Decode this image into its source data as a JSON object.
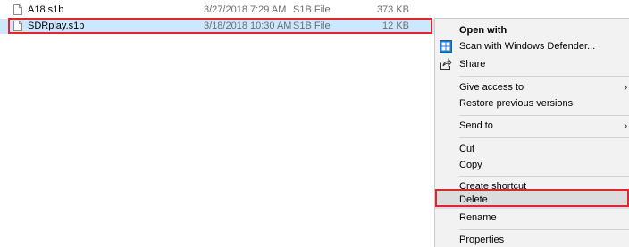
{
  "files": [
    {
      "name": "A18.s1b",
      "date": "3/27/2018 7:29 AM",
      "type": "S1B File",
      "size": "373 KB"
    },
    {
      "name": "SDRplay.s1b",
      "date": "3/18/2018 10:30 AM",
      "type": "S1B File",
      "size": "12 KB"
    }
  ],
  "context_menu": {
    "open_with": "Open with",
    "scan": "Scan with Windows Defender...",
    "share": "Share",
    "give_access": "Give access to",
    "restore": "Restore previous versions",
    "send_to": "Send to",
    "cut": "Cut",
    "copy": "Copy",
    "create_shortcut": "Create shortcut",
    "delete": "Delete",
    "rename": "Rename",
    "properties": "Properties",
    "submenu_arrow": "›"
  },
  "colors": {
    "selection": "#cce8ff",
    "highlight_outline": "#e0262a",
    "menu_background": "#f2f2f2"
  },
  "icons": {
    "file": "file-icon",
    "defender": "windows-defender-icon",
    "share": "share-icon"
  }
}
